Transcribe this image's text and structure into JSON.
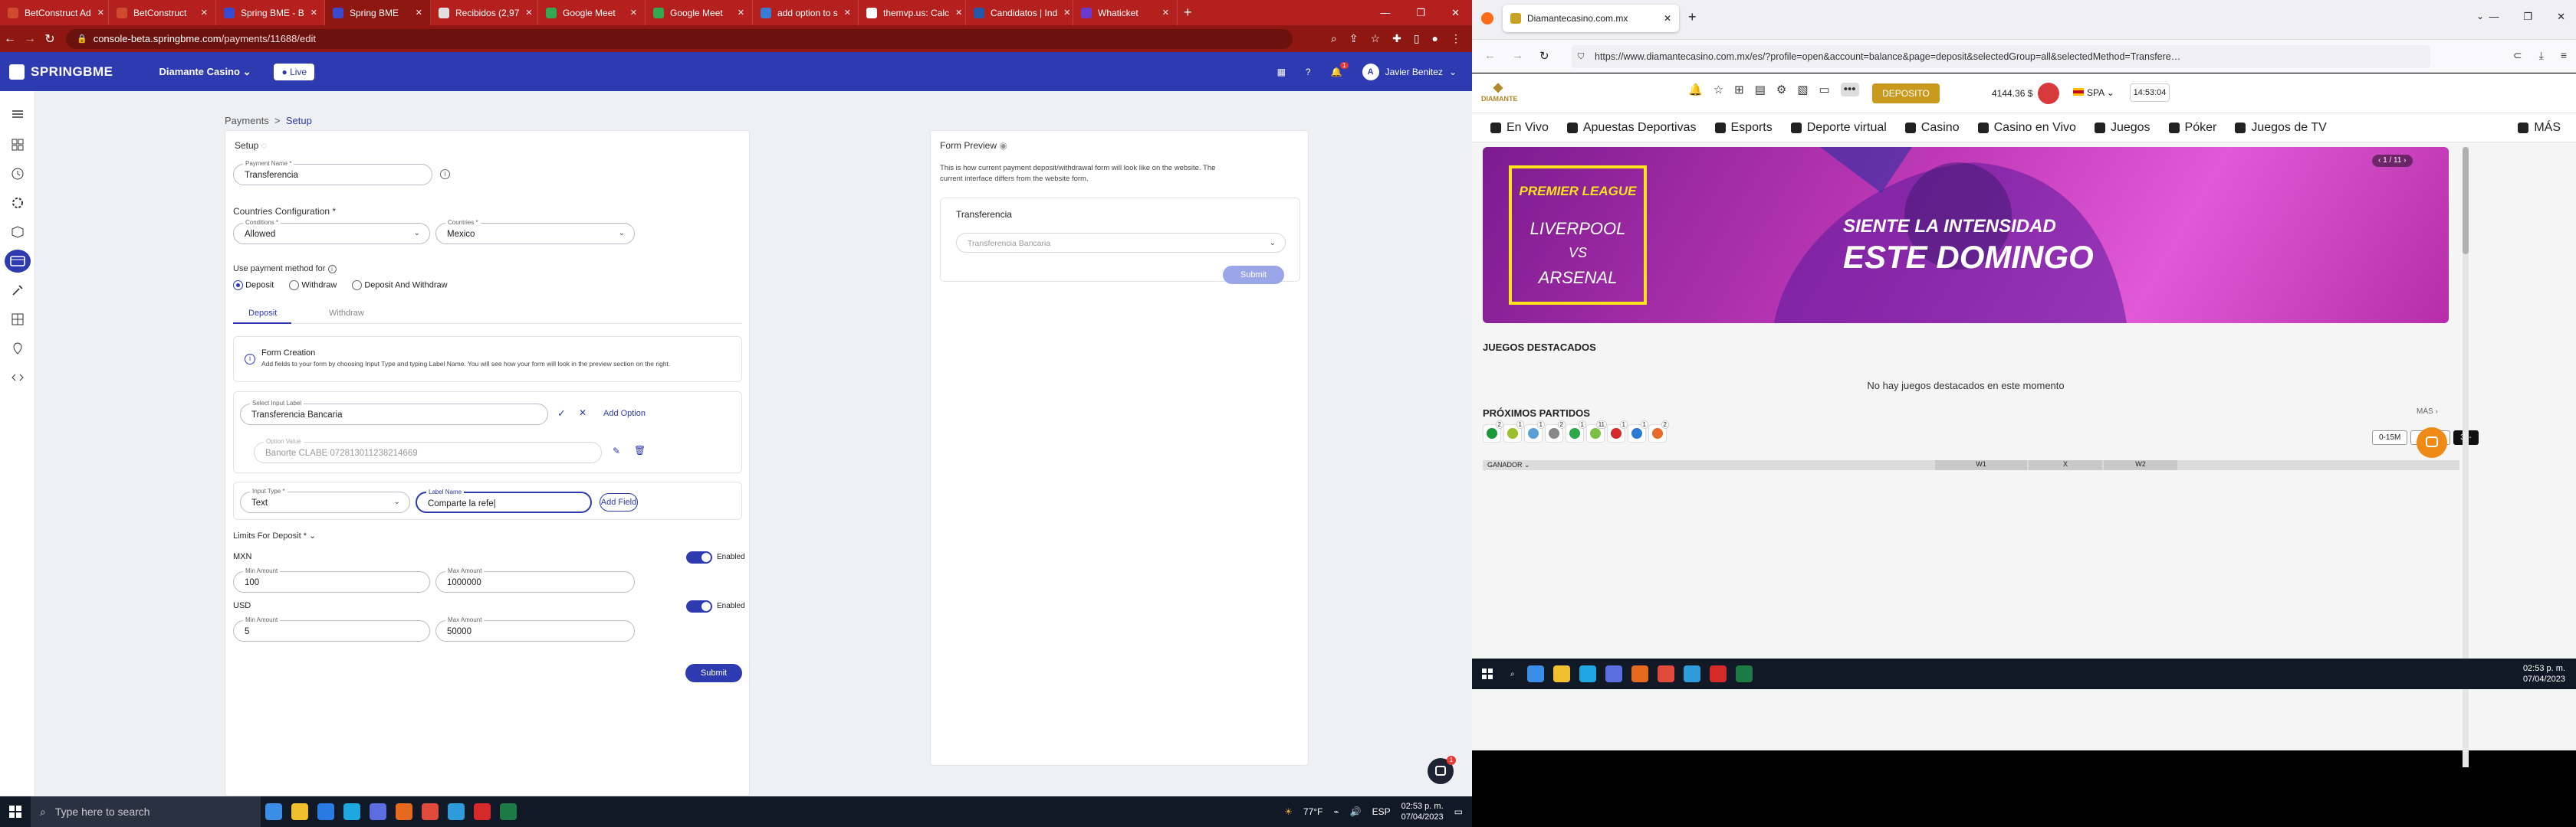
{
  "left_browser": {
    "tabs": [
      {
        "label": "BetConstruct Ad",
        "color": "#d04a2e"
      },
      {
        "label": "BetConstruct",
        "color": "#d04a2e"
      },
      {
        "label": "Spring BME - B",
        "color": "#3a4ad0"
      },
      {
        "label": "Spring BME",
        "color": "#3a4ad0",
        "active": true
      },
      {
        "label": "Recibidos (2,97",
        "color": "#e0e0e0"
      },
      {
        "label": "Google Meet",
        "color": "#34a853"
      },
      {
        "label": "Google Meet",
        "color": "#34a853"
      },
      {
        "label": "add option to s",
        "color": "#3a7bd5"
      },
      {
        "label": "themvp.us: Calc",
        "color": "#ffffff"
      },
      {
        "label": "Candidatos | Ind",
        "color": "#2557a7"
      },
      {
        "label": "Whaticket",
        "color": "#6a3ad0"
      }
    ],
    "url_host": "console-beta.springbme.com",
    "url_path": "/payments/11688/edit"
  },
  "app": {
    "logo": "SPRINGBME",
    "brand_select": "Diamante Casino",
    "live_label": "Live",
    "user_name": "Javier Benitez",
    "notif_count": "1"
  },
  "breadcrumb": {
    "root": "Payments",
    "sep": ">",
    "current": "Setup"
  },
  "setup": {
    "title": "Setup",
    "payment_name_label": "Payment Name *",
    "payment_name_value": "Transferencia",
    "countries_config_title": "Countries Configuration *",
    "conditions_label": "Conditions *",
    "conditions_value": "Allowed",
    "countries_label": "Countries *",
    "countries_value": "Mexico",
    "use_method_label": "Use payment method for",
    "radios": [
      "Deposit",
      "Withdraw",
      "Deposit And Withdraw"
    ],
    "tabs": [
      "Deposit",
      "Withdraw"
    ],
    "form_creation_title": "Form Creation",
    "form_creation_desc": "Add fields to your form by choosing Input Type and typing Label Name. You will see how your form will look in the preview section on the right.",
    "select_input_label_label": "Select Input Label",
    "select_input_label_value": "Transferencia Bancaria",
    "add_option": "Add Option",
    "option_value_label": "Option Value",
    "option_value": "Banorte CLABE 072813011238214669",
    "input_type_label": "Input Type *",
    "input_type_value": "Text",
    "label_name_label": "Label Name",
    "label_name_value": "Comparte la refe",
    "add_field": "Add Field",
    "limits_title": "Limits For Deposit *",
    "limits": [
      {
        "currency": "MXN",
        "status": "Enabled",
        "min_label": "Min Amount",
        "min": "100",
        "max_label": "Max Amount",
        "max": "1000000"
      },
      {
        "currency": "USD",
        "status": "Enabled",
        "min_label": "Min Amount",
        "min": "5",
        "max_label": "Max Amount",
        "max": "50000"
      }
    ],
    "submit": "Submit"
  },
  "preview": {
    "title": "Form Preview",
    "desc1": "This is how current payment deposit/withdrawal form will look like on the website. The",
    "desc2": "current interface differs from the website form.",
    "card_title": "Transferencia",
    "select_placeholder": "Transferencia Bancaria",
    "submit": "Submit"
  },
  "chat_badge": "1",
  "left_taskbar": {
    "search_placeholder": "Type here to search",
    "weather": "77°F",
    "lang": "ESP",
    "time": "02:53 p. m.",
    "date": "07/04/2023"
  },
  "right_browser": {
    "tab_title": "Diamantecasino.com.mx",
    "url": "https://www.diamantecasino.com.mx/es/?profile=open&account=balance&page=deposit&selectedGroup=all&selectedMethod=Transfere…",
    "site": {
      "logo": "DIAMANTE",
      "deposit_btn": "DEPOSITO",
      "balance": "4144.36 $",
      "lang": "SPA",
      "clock": "14:53:04",
      "nav": [
        "En Vivo",
        "Apuestas Deportivas",
        "Esports",
        "Deporte virtual",
        "Casino",
        "Casino en Vivo",
        "Juegos",
        "Póker",
        "Juegos de TV",
        "MÁS"
      ],
      "banner": {
        "league": "PREMIER LEAGUE",
        "team1": "LIVERPOOL",
        "vs": "VS",
        "team2": "ARSENAL",
        "slogan1": "SIENTE LA INTENSIDAD",
        "slogan2": "ESTE DOMINGO",
        "pager": "1 / 11"
      },
      "featured_title": "JUEGOS DESTACADOS",
      "featured_empty": "No hay juegos destacados en este momento",
      "upcoming_title": "PRÓXIMOS PARTIDOS",
      "more": "MÁS",
      "sport_counts": [
        "2",
        "1",
        "1",
        "2",
        "1",
        "11",
        "1",
        "1",
        "2"
      ],
      "time_filters": [
        "0-15M",
        "15-30M",
        "30-"
      ],
      "market": "GANADOR",
      "cols": [
        "W1",
        "X",
        "W2"
      ]
    },
    "taskbar_time": "02:53 p. m.",
    "taskbar_date": "07/04/2023"
  }
}
